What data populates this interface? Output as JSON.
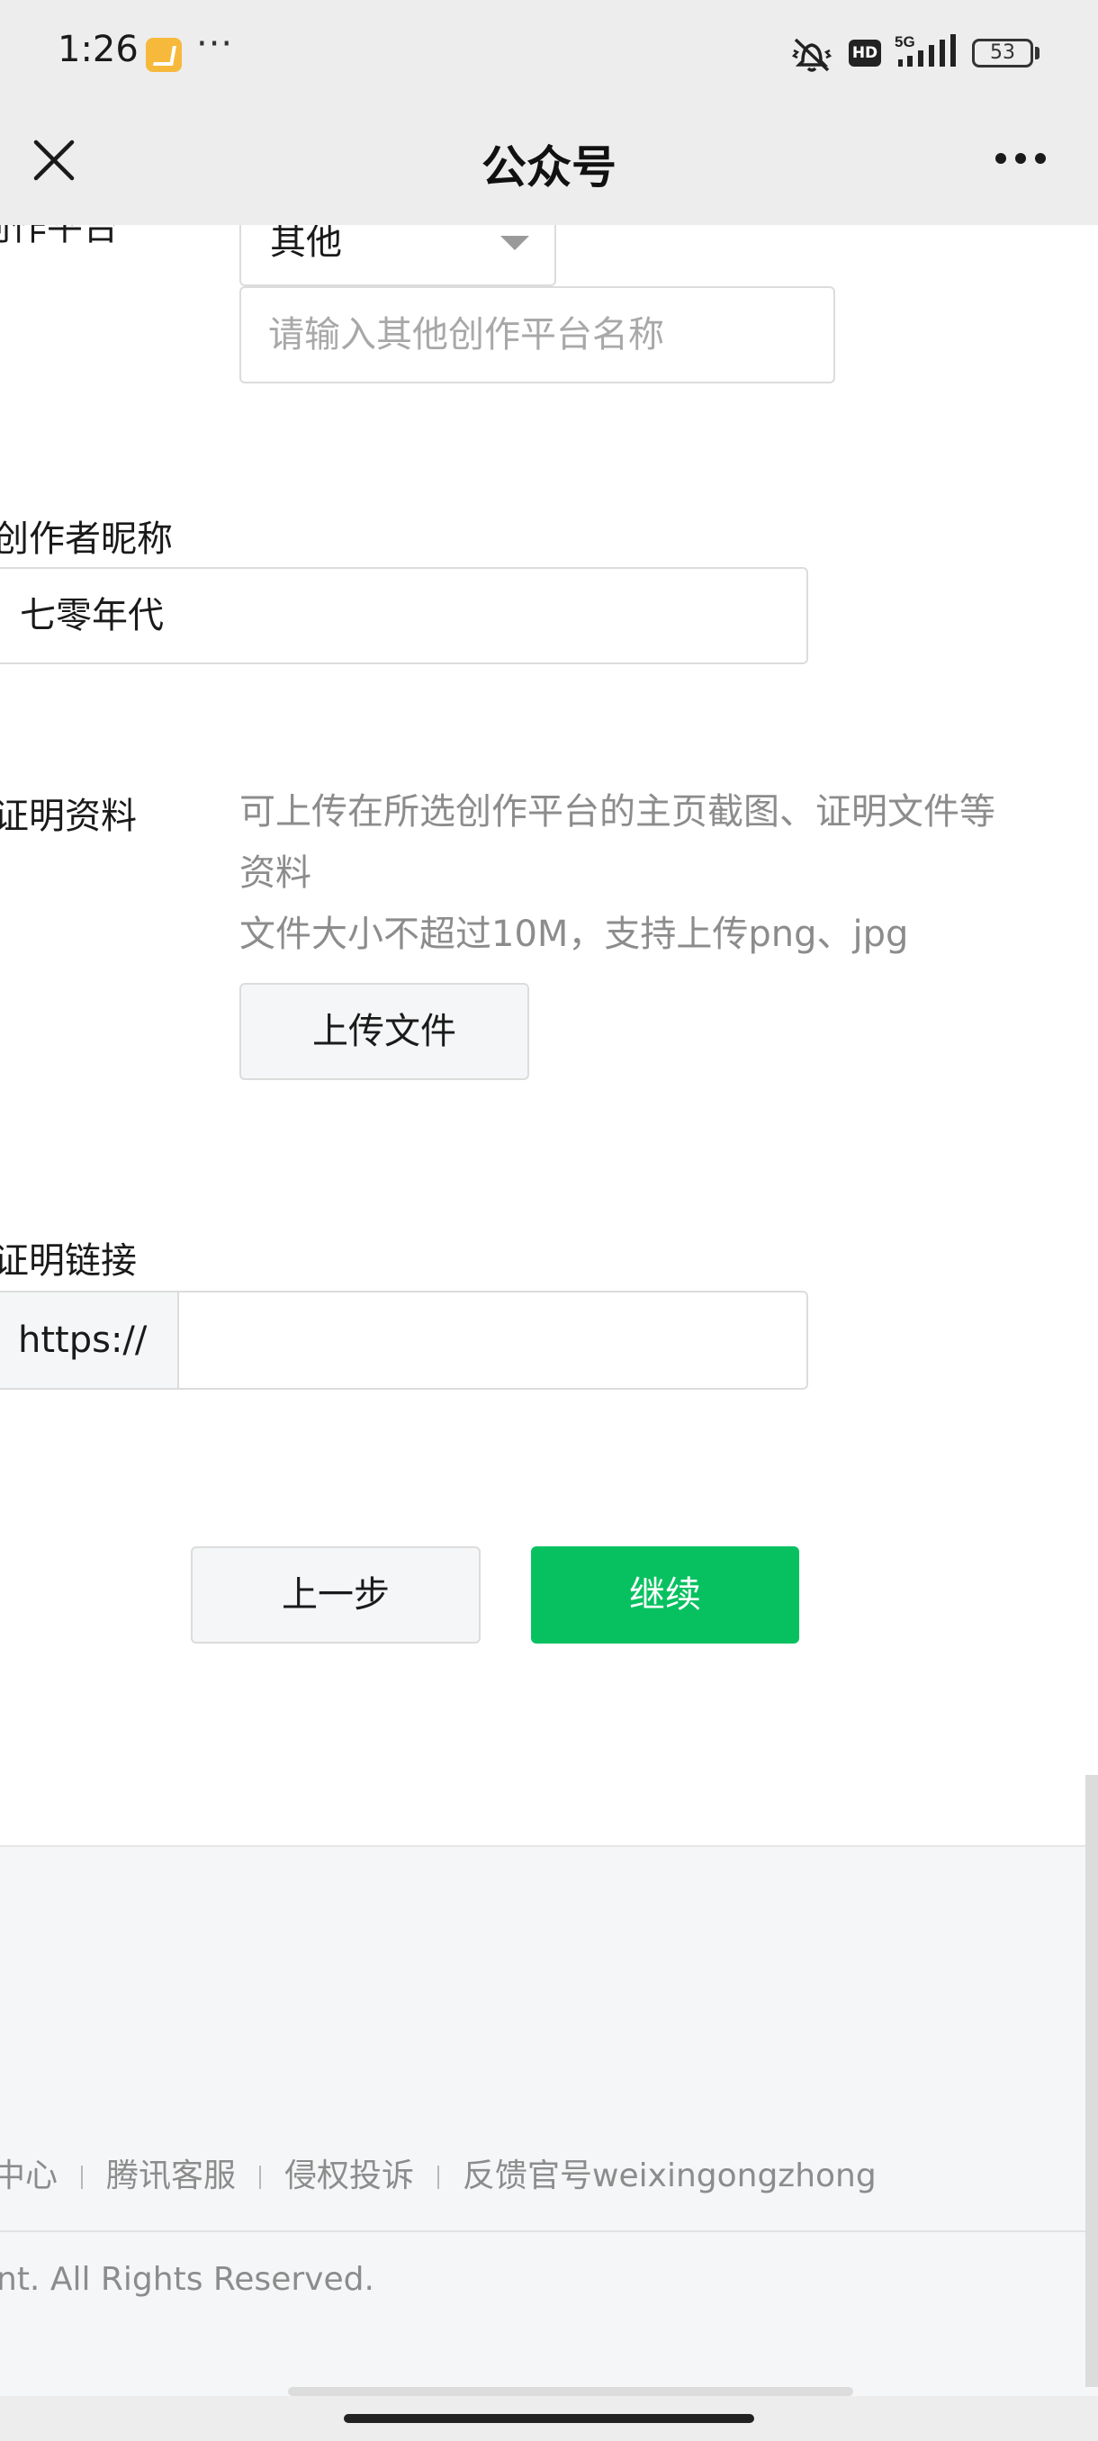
{
  "status_bar": {
    "time": "1:26",
    "dots": "···",
    "hd": "HD",
    "network": "5G",
    "battery": "53"
  },
  "nav": {
    "title": "公众号"
  },
  "form": {
    "platform_label": "创作平台",
    "platform_value": "其他",
    "other_platform_placeholder": "请输入其他创作平台名称",
    "nickname_label": "创作者昵称",
    "nickname_value": "七零年代",
    "proof_label": "证明资料",
    "proof_hint_line1": "可上传在所选创作平台的主页截图、证明文件等资料",
    "proof_hint_line2": "文件大小不超过10M，支持上传png、jpg",
    "upload_button": "上传文件",
    "link_label": "证明链接",
    "link_prefix": "https://",
    "link_value": ""
  },
  "actions": {
    "back_button": "上一步",
    "continue_button": "继续",
    "primary_color": "#07c160"
  },
  "footer": {
    "links": [
      "中心",
      "腾讯客服",
      "侵权投诉",
      "反馈官号weixingongzhong"
    ],
    "copyright": "nt. All Rights Reserved."
  }
}
